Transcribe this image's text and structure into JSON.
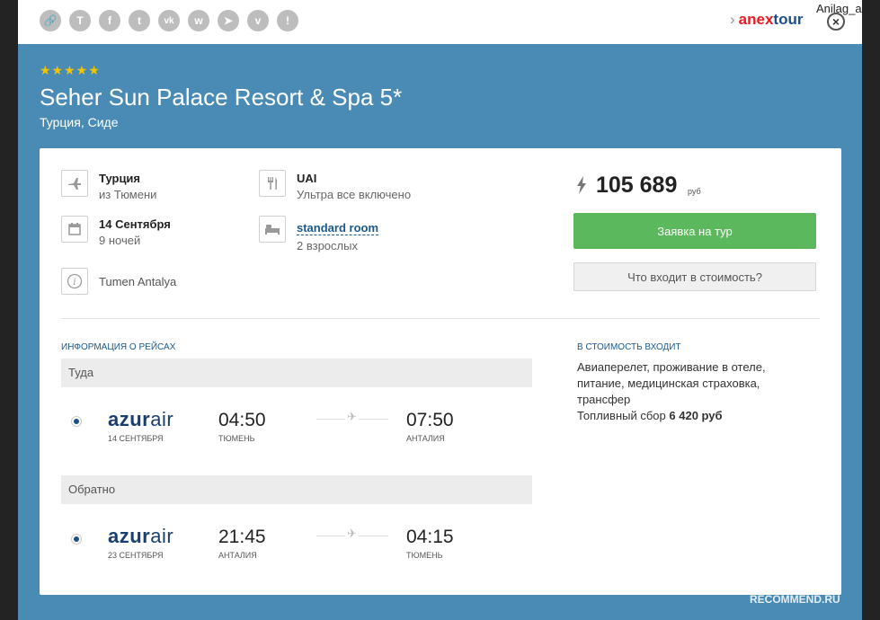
{
  "user": {
    "name": "Anilag_ani"
  },
  "share_icons": [
    {
      "name": "link-icon",
      "glyph": "🔗"
    },
    {
      "name": "t-icon",
      "glyph": "T"
    },
    {
      "name": "facebook-icon",
      "glyph": "f"
    },
    {
      "name": "twitter-icon",
      "glyph": "t"
    },
    {
      "name": "vk-icon",
      "glyph": "vk"
    },
    {
      "name": "whatsapp-icon",
      "glyph": "w"
    },
    {
      "name": "telegram-icon",
      "glyph": "➤"
    },
    {
      "name": "viber-icon",
      "glyph": "v"
    },
    {
      "name": "report-icon",
      "glyph": "!"
    }
  ],
  "brand": {
    "part1": "anex",
    "part2": "tour"
  },
  "hotel": {
    "stars": "★★★★★",
    "name": "Seher Sun Palace Resort & Spa 5*",
    "location": "Турция, Сиде"
  },
  "tour": {
    "country": "Турция",
    "from": "из Тюмени",
    "date": "14 Сентября",
    "nights": "9 ночей",
    "info": "Tumen Antalya",
    "meal_code": "UAI",
    "meal_desc": "Ультра все включено",
    "room": "standard room",
    "guests": "2 взрослых"
  },
  "price": {
    "value": "105 689",
    "currency": "руб"
  },
  "buttons": {
    "order": "Заявка на тур",
    "whats_included": "Что входит в стоимость?"
  },
  "flights": {
    "heading": "Информация о рейсах",
    "outbound_label": "Туда",
    "return_label": "Обратно",
    "outbound": {
      "airline_bold": "azur",
      "airline_light": "air",
      "date": "14 сентября",
      "dep_time": "04:50",
      "dep_city": "Тюмень",
      "arr_time": "07:50",
      "arr_city": "Анталия"
    },
    "return": {
      "airline_bold": "azur",
      "airline_light": "air",
      "date": "23 сентября",
      "dep_time": "21:45",
      "dep_city": "Анталия",
      "arr_time": "04:15",
      "arr_city": "Тюмень"
    }
  },
  "included": {
    "heading": "В стоимость входит",
    "line1": "Авиаперелет, проживание в отеле,",
    "line2": "питание, медицинская страховка,",
    "line3": "трансфер",
    "fuel_label": "Топливный сбор",
    "fuel_value": "6 420 руб"
  },
  "watermark": "RECOMMEND.RU",
  "colors": {
    "header_blue": "#4a8bb5",
    "button_green": "#5cb85c",
    "link_blue": "#1a5a8e",
    "star_yellow": "#f3c500"
  }
}
